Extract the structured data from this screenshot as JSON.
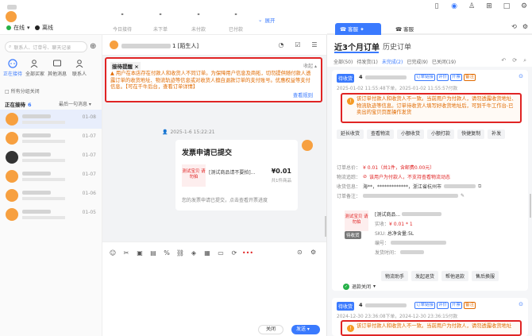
{
  "header": {
    "online_status": "在线",
    "leave_status": "离线",
    "stats": [
      {
        "label": "今日接待",
        "value": "-"
      },
      {
        "label": "未下单",
        "value": "-"
      },
      {
        "label": "未付款",
        "value": "-"
      },
      {
        "label": "已付款",
        "value": "-"
      }
    ],
    "expand_label": "展开"
  },
  "left": {
    "search_placeholder": "联系人、订单号、聊天记录",
    "tabs": [
      {
        "label": "正在接待",
        "icon": "chat-icon"
      },
      {
        "label": "全部买家",
        "icon": "users-icon"
      },
      {
        "label": "其他消息",
        "icon": "message-icon"
      },
      {
        "label": "联系人",
        "icon": "contact-icon"
      }
    ],
    "no_group": "所有分组关闭",
    "reception_label": "正在接待",
    "reception_count": "6",
    "sort_label": "最后一句消息",
    "conversations": [
      {
        "date": "01-08"
      },
      {
        "date": "01-07"
      },
      {
        "date": "01-07"
      },
      {
        "date": "01-07"
      },
      {
        "date": "01-06"
      },
      {
        "date": "01-05"
      }
    ]
  },
  "chat": {
    "title_suffix": "1 [陌生人]",
    "notice_tag": "接待提醒",
    "notice_collapse": "收起",
    "notice_body": "用户在本店存在付款人和收货人不同订单。为保障用户信息及商拓，切勿提供随付款人透露订单的收货地址、物流轨迹等信息或对收货人擅自退款订单的支付账号。优惠权益等支付信息。【可在千牛后台，查看订单详情】",
    "notice_rules": "查看规则",
    "msg_time": "2025-1-6 15:22:21",
    "card_title": "发票申请已提交",
    "card_thumb": "测试宝贝 请勿拍",
    "card_product": "[测试商品请不要拍]...",
    "card_price": "¥0.01",
    "card_count": "共1件商品",
    "card_desc": "您的发票申请已提交，点击查看开票进度",
    "close_button": "关闭",
    "send_button": "发送"
  },
  "right": {
    "tab_kefu": "客服",
    "tab_kefu2": "客服",
    "orders_tab": "近3个月订单",
    "history_tab": "历史订单",
    "filters": [
      "全部(50)",
      "待发货(1)",
      "未完成(2)",
      "已完成(9)",
      "已关闭(19)"
    ],
    "order1": {
      "status": "待收货",
      "num_prefix": "4",
      "tags": [
        "订单链接",
        "评价",
        "开票",
        "备注"
      ],
      "times": "2025-01-02 11:55:48下单，2025-01-02 11:55:57付款",
      "warning": "该订单付款人和收货人不一致。当前用户为付款人，请勿透露收货地址、物流轨迹等信息。订单待收货人填写好收货地址后，可到千牛工作台-已卖出的宝贝页面操作发货",
      "buttons": [
        "延长收货",
        "查看物流",
        "小额收货",
        "小额打款",
        "快捷复制",
        "补发"
      ],
      "total_label": "订单总价：",
      "total_value": "¥ 0.01（共1件，含邮费0.00元）",
      "logistics_label": "物流追踪：",
      "logistics_value": "该用户为付款人，不支持查看物流动态",
      "address_label": "收货信息：",
      "address_value": "海**，*************，浙江省杭州市",
      "remark_label": "订单备注：",
      "product_thumb": "测试宝贝 请勿拍",
      "product_status": "待收货",
      "product_title": "[测试商品...",
      "paid_label": "实收：",
      "paid_value": "¥ 0.01 * 1",
      "sku_label": "SKU:",
      "sku_value": "总净含量:5L",
      "code_label": "编号：",
      "ship_label": "发货时间：",
      "product_buttons": [
        "物流助手",
        "发起退货",
        "帮他退款",
        "售后换服"
      ],
      "refund": "退款关闭"
    },
    "order2": {
      "status": "待收货",
      "num_prefix": "4",
      "tags": [
        "订单链接",
        "评价",
        "开票",
        "备注"
      ],
      "times": "2024-12-30 23:36:08下单，2024-12-30 23:36:15付款",
      "warning": "该订单付款人和收货人不一致。当前用户为付款人，请勿透露收货地址"
    }
  }
}
